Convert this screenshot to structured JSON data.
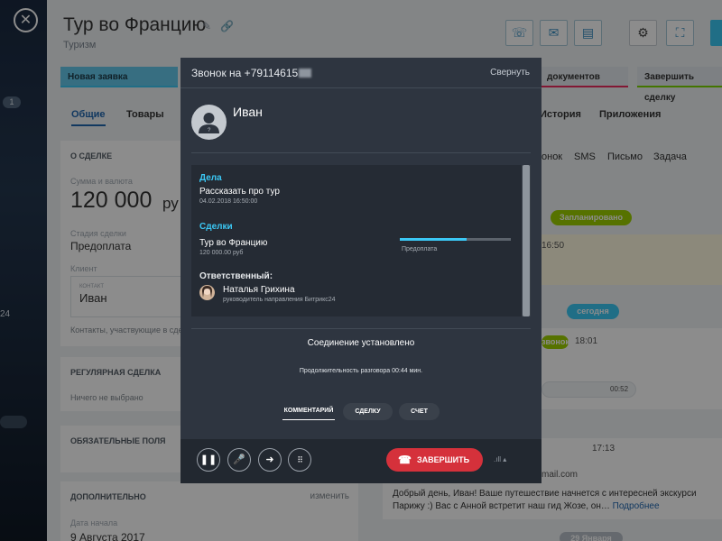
{
  "sidebar": {
    "badge": "1",
    "number": "24"
  },
  "deal": {
    "title": "Тур во Францию",
    "subtitle": "Туризм",
    "stages": [
      "Новая заявка",
      "Подготовка документов",
      "Завершить сделку"
    ],
    "stage_visible_1": "документов",
    "tabs_left": [
      "Общие",
      "Товары"
    ],
    "tabs_right": [
      "История",
      "Приложения"
    ],
    "about": {
      "header": "О СДЕЛКЕ",
      "amount_label": "Сумма и валюта",
      "amount": "120 000",
      "currency_part": "ру",
      "stage_label": "Стадия сделки",
      "stage_value": "Предоплата",
      "client_label": "Клиент",
      "contact_label": "КОНТАКТ",
      "contact_value": "Иван",
      "participants": "Контакты, участвующие в сде"
    },
    "regular": {
      "header": "РЕГУЛЯРНАЯ СДЕЛКА",
      "value": "Ничего не выбрано"
    },
    "required": {
      "header": "ОБЯЗАТЕЛЬНЫЕ ПОЛЯ"
    },
    "additional": {
      "header": "ДОПОЛНИТЕЛЬНО",
      "action": "изменить",
      "start_label": "Дата начала",
      "start_value": "9 Августа 2017"
    },
    "activity_tabs": [
      "онок",
      "SMS",
      "Письмо",
      "Задача"
    ],
    "timeline": {
      "planned": "Запланировано",
      "planned_time": "16:50",
      "today": "сегодня",
      "call_badge": "звонок",
      "call_time": "18:01",
      "audio_time": "00:52",
      "email_time": "17:13",
      "email_addr_part": "mail.com",
      "message": "Добрый день, Иван!  Ваше путешествие начнется с интересней экскурси Парижу :) Вас с Анной встретит наш гид Жозе, он…",
      "more": "Подробнее",
      "date": "29 Января"
    }
  },
  "call": {
    "number": "Звонок на +79114615",
    "minimize": "Свернуть",
    "contact_name": "Иван",
    "tasks_header": "Дела",
    "task_title": "Рассказать про тур",
    "task_date": "04.02.2018 16:50:00",
    "deals_header": "Сделки",
    "deal_title": "Тур во Францию",
    "deal_amount": "120 000.00 руб",
    "deal_stage": "Предоплата",
    "deal_progress": 0.6,
    "responsible_header": "Ответственный:",
    "responsible_name": "Наталья Грихина",
    "responsible_role": "руководитель направления Битрикс24",
    "status": "Соединение установлено",
    "duration": "Продолжительность разговора 00:44 мин.",
    "tabs": [
      "КОММЕНТАРИЙ",
      "СДЕЛКУ",
      "СЧЕТ"
    ],
    "end_label": "ЗАВЕРШИТЬ"
  }
}
